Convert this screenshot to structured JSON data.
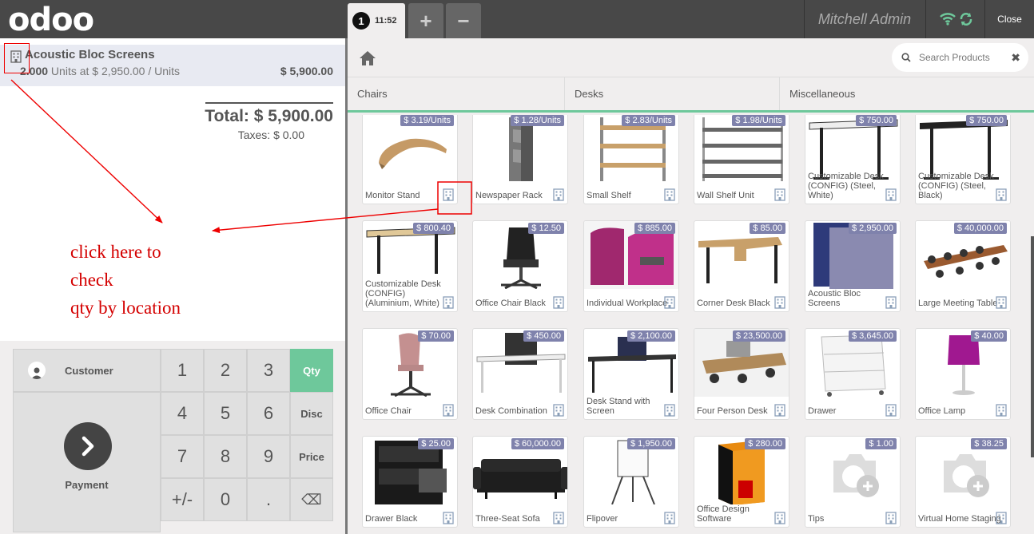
{
  "header": {
    "logo": "odoo",
    "order_number": "1",
    "order_time": "11:52",
    "add_label": "+",
    "remove_label": "−",
    "cashier": "Mitchell Admin",
    "close_label": "Close"
  },
  "order": {
    "line": {
      "product": "Acoustic Bloc Screens",
      "qty": "2.000",
      "unit_info": " Units at $ 2,950.00 / Units",
      "price": "$ 5,900.00"
    },
    "total": "Total: $ 5,900.00",
    "taxes": "Taxes: $ 0.00"
  },
  "annotation": {
    "line1": "click here to",
    "line2": "check",
    "line3": "qty by location"
  },
  "pad": {
    "customer": "Customer",
    "payment": "Payment",
    "keys": [
      "1",
      "2",
      "3",
      "4",
      "5",
      "6",
      "7",
      "8",
      "9",
      "+/-",
      "0",
      "."
    ],
    "modes": [
      "Qty",
      "Disc",
      "Price"
    ],
    "backspace": "⌫"
  },
  "search": {
    "placeholder": "Search Products"
  },
  "categories": [
    "Chairs",
    "Desks",
    "Miscellaneous"
  ],
  "products": [
    {
      "name": "Monitor Stand",
      "price": "$ 3.19/Units"
    },
    {
      "name": "Newspaper Rack",
      "price": "$ 1.28/Units"
    },
    {
      "name": "Small Shelf",
      "price": "$ 2.83/Units"
    },
    {
      "name": "Wall Shelf Unit",
      "price": "$ 1.98/Units"
    },
    {
      "name": "Customizable Desk (CONFIG) (Steel, White)",
      "price": "$ 750.00"
    },
    {
      "name": "Customizable Desk (CONFIG) (Steel, Black)",
      "price": "$ 750.00"
    },
    {
      "name": "Customizable Desk (CONFIG) (Aluminium, White)",
      "price": "$ 800.40"
    },
    {
      "name": "Office Chair Black",
      "price": "$ 12.50"
    },
    {
      "name": "Individual Workplace",
      "price": "$ 885.00"
    },
    {
      "name": "Corner Desk Black",
      "price": "$ 85.00"
    },
    {
      "name": "Acoustic Bloc Screens",
      "price": "$ 2,950.00"
    },
    {
      "name": "Large Meeting Table",
      "price": "$ 40,000.00"
    },
    {
      "name": "Office Chair",
      "price": "$ 70.00"
    },
    {
      "name": "Desk Combination",
      "price": "$ 450.00"
    },
    {
      "name": "Desk Stand with Screen",
      "price": "$ 2,100.00"
    },
    {
      "name": "Four Person Desk",
      "price": "$ 23,500.00"
    },
    {
      "name": "Drawer",
      "price": "$ 3,645.00"
    },
    {
      "name": "Office Lamp",
      "price": "$ 40.00"
    },
    {
      "name": "Drawer Black",
      "price": "$ 25.00"
    },
    {
      "name": "Three-Seat Sofa",
      "price": "$ 60,000.00"
    },
    {
      "name": "Flipover",
      "price": "$ 1,950.00"
    },
    {
      "name": "Office Design Software",
      "price": "$ 280.00"
    },
    {
      "name": "Tips",
      "price": "$ 1.00"
    },
    {
      "name": "Virtual Home Staging",
      "price": "$ 38.25"
    }
  ],
  "colors": {
    "header_bg": "#484848",
    "accent_green": "#6ec89b",
    "price_tag": "#7f82ac",
    "annotation_red": "#d40000"
  }
}
